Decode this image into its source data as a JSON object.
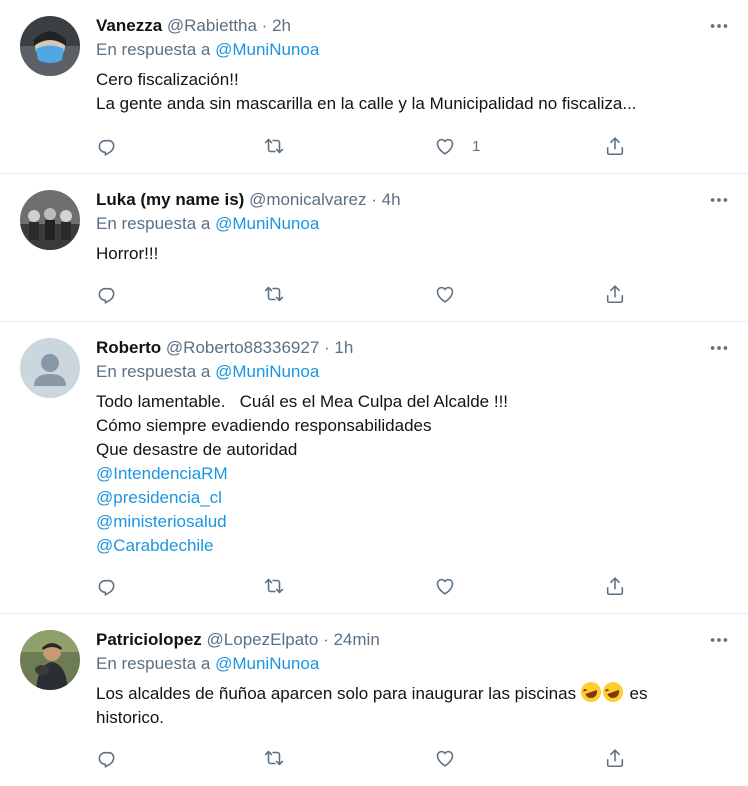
{
  "tweets": [
    {
      "name": "Vanezza",
      "handle": "@Rabiettha",
      "dot": "·",
      "time": "2h",
      "reply_prefix": "En respuesta a",
      "reply_to": "@MuniNunoa",
      "lines": [
        "Cero fiscalización!!",
        "La gente anda sin mascarilla en la calle y la Municipalidad no fiscaliza..."
      ],
      "like_count": "1"
    },
    {
      "name": "Luka (my name is)",
      "handle": "@monicalvarez",
      "dot": "·",
      "time": "4h",
      "reply_prefix": "En respuesta a",
      "reply_to": "@MuniNunoa",
      "lines": [
        "Horror!!!"
      ],
      "like_count": ""
    },
    {
      "name": "Roberto",
      "handle": "@Roberto88336927",
      "dot": "·",
      "time": "1h",
      "reply_prefix": "En respuesta a",
      "reply_to": "@MuniNunoa",
      "lines": [
        "Todo lamentable.   Cuál es el Mea Culpa del Alcalde !!!",
        "Cómo siempre evadiendo responsabilidades",
        "Que desastre de autoridad"
      ],
      "mentions": [
        "@IntendenciaRM",
        "@presidencia_cl",
        "@ministeriosalud",
        "@Carabdechile"
      ],
      "like_count": ""
    },
    {
      "name": "Patriciolopez",
      "handle": "@LopezElpato",
      "dot": "·",
      "time": "24min",
      "reply_prefix": "En respuesta a",
      "reply_to": "@MuniNunoa",
      "text_before_emoji": "Los alcaldes de ñuñoa aparcen solo para inaugurar las piscinas ",
      "emoji": [
        "rolling-on-floor-laughing-emoji",
        "rolling-on-floor-laughing-emoji"
      ],
      "text_after_emoji": " es historico.",
      "like_count": ""
    }
  ],
  "colors": {
    "link": "#1b95e0",
    "muted": "#5b7083",
    "text": "#0f1419",
    "divider": "#e6ecf0"
  },
  "icons": {
    "more": "more-icon",
    "reply": "reply-icon",
    "retweet": "retweet-icon",
    "like": "like-icon",
    "share": "share-icon"
  }
}
